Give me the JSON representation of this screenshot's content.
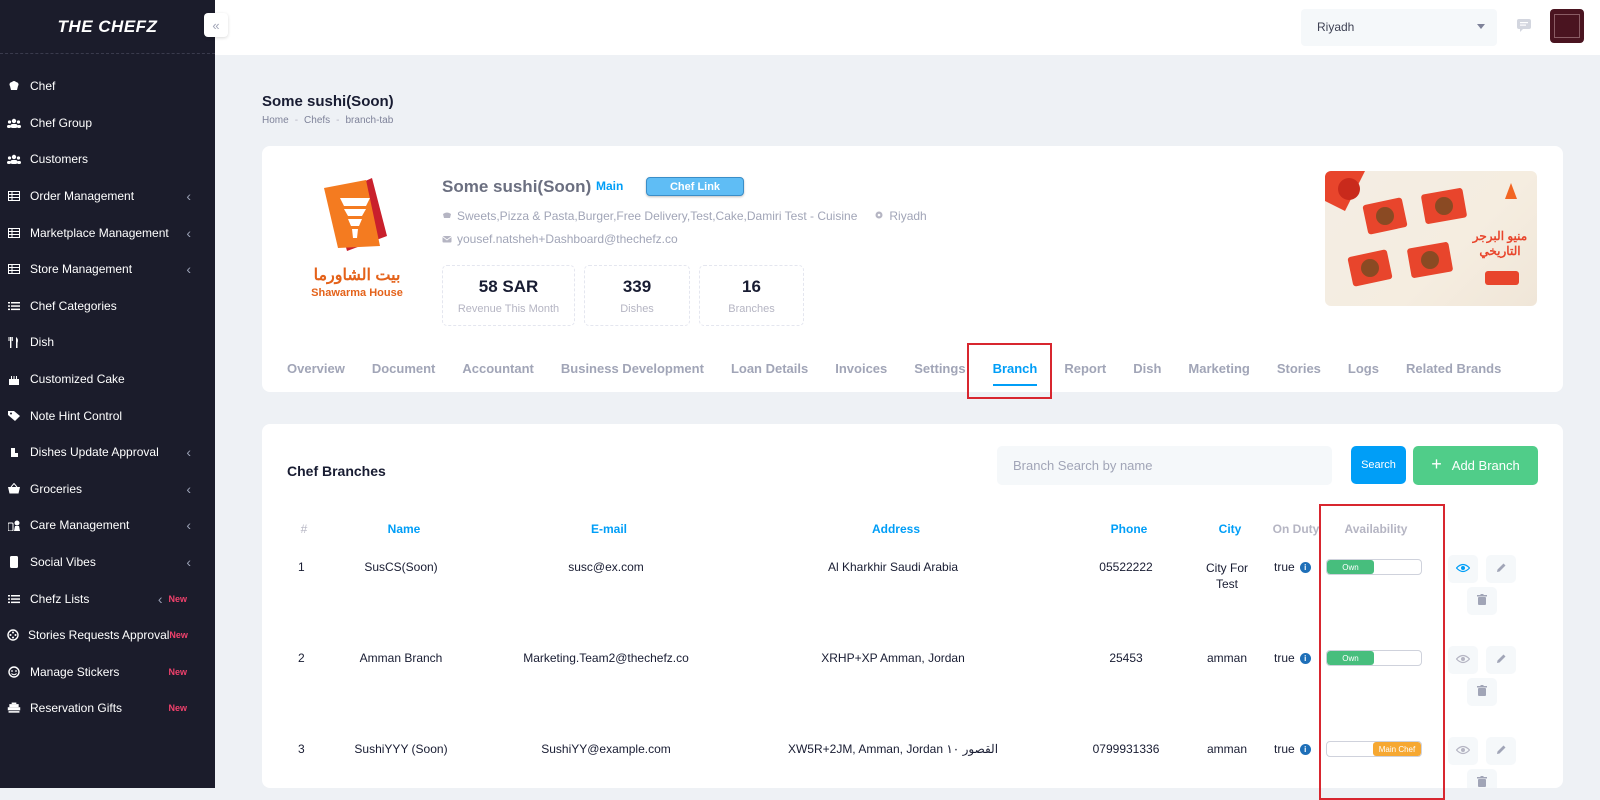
{
  "sidebar": {
    "logo": "THE CHEFZ",
    "items": [
      {
        "label": "Chef",
        "icon": "chef-hat-icon",
        "chevron": false,
        "new": ""
      },
      {
        "label": "Chef Group",
        "icon": "users-icon",
        "chevron": false,
        "new": ""
      },
      {
        "label": "Customers",
        "icon": "users-icon",
        "chevron": false,
        "new": ""
      },
      {
        "label": "Order Management",
        "icon": "table-icon",
        "chevron": true,
        "new": ""
      },
      {
        "label": "Marketplace Management",
        "icon": "table-icon",
        "chevron": true,
        "new": ""
      },
      {
        "label": "Store Management",
        "icon": "table-icon",
        "chevron": true,
        "new": ""
      },
      {
        "label": "Chef Categories",
        "icon": "list-icon",
        "chevron": false,
        "new": ""
      },
      {
        "label": "Dish",
        "icon": "utensils-icon",
        "chevron": false,
        "new": ""
      },
      {
        "label": "Customized Cake",
        "icon": "cake-icon",
        "chevron": false,
        "new": ""
      },
      {
        "label": "Note Hint Control",
        "icon": "tag-icon",
        "chevron": false,
        "new": ""
      },
      {
        "label": "Dishes Update Approval",
        "icon": "approval-icon",
        "chevron": true,
        "new": ""
      },
      {
        "label": "Groceries",
        "icon": "basket-icon",
        "chevron": true,
        "new": ""
      },
      {
        "label": "Care Management",
        "icon": "care-icon",
        "chevron": true,
        "new": ""
      },
      {
        "label": "Social Vibes",
        "icon": "phone-icon",
        "chevron": true,
        "new": ""
      },
      {
        "label": "Chefz Lists",
        "icon": "list-icon",
        "chevron": true,
        "new": "New"
      },
      {
        "label": "Stories Requests Approval",
        "icon": "film-icon",
        "chevron": false,
        "new": "New"
      },
      {
        "label": "Manage Stickers",
        "icon": "sticker-icon",
        "chevron": false,
        "new": "New"
      },
      {
        "label": "Reservation Gifts",
        "icon": "gift-icon",
        "chevron": false,
        "new": "New"
      }
    ]
  },
  "topbar": {
    "city": "Riyadh"
  },
  "page": {
    "title": "Some sushi(Soon)",
    "breadcrumb": [
      "Home",
      "Chefs",
      "branch-tab"
    ]
  },
  "profile": {
    "brand_name_ar": "بيت الشاورما",
    "brand_name_en": "Shawarma House",
    "name": "Some sushi(Soon)",
    "badge": "Main",
    "chef_link": "Chef Link",
    "cuisine": "Sweets,Pizza & Pasta,Burger,Free Delivery,Test,Cake,Damiri Test - Cuisine",
    "city": "Riyadh",
    "email": "yousef.natsheh+Dashboard@thechefz.co",
    "stats": [
      {
        "value": "58 SAR",
        "label": "Revenue This Month"
      },
      {
        "value": "339",
        "label": "Dishes"
      },
      {
        "value": "16",
        "label": "Branches"
      }
    ],
    "cover_text": "منيو البرجر التاريخي"
  },
  "tabs": [
    {
      "label": "Overview",
      "active": false
    },
    {
      "label": "Document",
      "active": false
    },
    {
      "label": "Accountant",
      "active": false
    },
    {
      "label": "Business Development",
      "active": false
    },
    {
      "label": "Loan Details",
      "active": false
    },
    {
      "label": "Invoices",
      "active": false
    },
    {
      "label": "Settings",
      "active": false
    },
    {
      "label": "Branch",
      "active": true
    },
    {
      "label": "Report",
      "active": false
    },
    {
      "label": "Dish",
      "active": false
    },
    {
      "label": "Marketing",
      "active": false
    },
    {
      "label": "Stories",
      "active": false
    },
    {
      "label": "Logs",
      "active": false
    },
    {
      "label": "Related Brands",
      "active": false
    }
  ],
  "branches": {
    "title": "Chef Branches",
    "search_placeholder": "Branch Search by name",
    "search_label": "Search",
    "add_label": "Add Branch",
    "columns": [
      "#",
      "Name",
      "E-mail",
      "Address",
      "Phone",
      "City",
      "On Duty",
      "Availability"
    ],
    "rows": [
      {
        "num": "1",
        "name": "SusCS(Soon)",
        "email": "susc@ex.com",
        "address": "Al Kharkhir Saudi Arabia",
        "phone": "05522222",
        "city": "City For Test",
        "on_duty": "true",
        "availability": "Own"
      },
      {
        "num": "2",
        "name": "Amman Branch",
        "email": "Marketing.Team2@thechefz.co",
        "address": "XRHP+XP Amman, Jordan",
        "phone": "25453",
        "city": "amman",
        "on_duty": "true",
        "availability": "Own"
      },
      {
        "num": "3",
        "name": "SushiYYY (Soon)",
        "email": "SushiYY@example.com",
        "address": "XW5R+2JM, Amman, Jordan القصور ١٠",
        "phone": "0799931336",
        "city": "amman",
        "on_duty": "true",
        "availability": "Main Chef"
      }
    ]
  },
  "colors": {
    "sidebar_bg": "#1b1c2b",
    "primary": "#009ef7",
    "success": "#50cd89",
    "warning": "#f6a832",
    "highlight": "#d8262f"
  }
}
